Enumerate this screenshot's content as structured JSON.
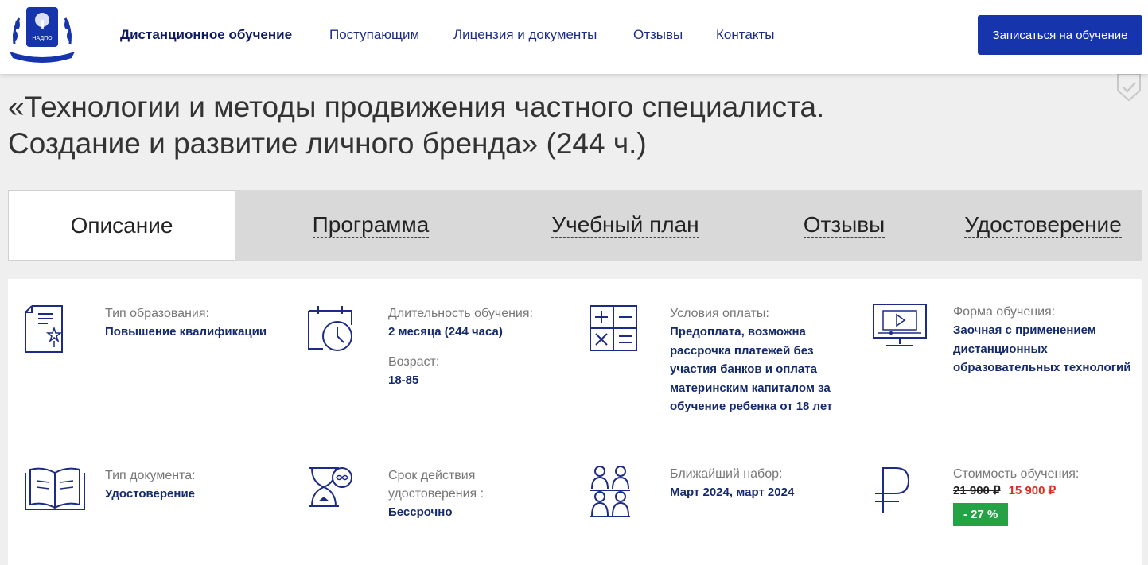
{
  "header": {
    "logo_text": "НАДПО",
    "nav": [
      "Дистанционное обучение",
      "Поступающим",
      "Лицензия и документы",
      "Отзывы",
      "Контакты"
    ],
    "cta_label": "Записаться на обучение"
  },
  "title": {
    "line1": "«Технологии и методы продвижения частного специалиста.",
    "line2": "Создание и развитие личного бренда» (244 ч.)"
  },
  "tabs": [
    "Описание",
    "Программа",
    "Учебный план",
    "Отзывы",
    "Удостоверение"
  ],
  "info": {
    "edu_type": {
      "label": "Тип образования:",
      "value": "Повышение квалификации"
    },
    "duration": {
      "label": "Длительность обучения:",
      "value": "2 месяца (244 часа)",
      "age_label": "Возраст:",
      "age_value": "18-85"
    },
    "payment": {
      "label": "Условия оплаты:",
      "value": "Предоплата, возможна рассрочка платежей без участия банков и оплата материнским капиталом за обучение ребенка от 18 лет"
    },
    "form": {
      "label": "Форма обучения:",
      "value": "Заочная с применением дистанционных образовательных технологий"
    },
    "doc_type": {
      "label": "Тип документа:",
      "value": "Удостоверение"
    },
    "validity": {
      "label": "Срок действия удостоверения :",
      "value": "Бессрочно"
    },
    "intake": {
      "label": "Ближайший набор:",
      "value": "Март 2024, март 2024"
    },
    "price": {
      "label": "Стоимость обучения:",
      "old": "21 900 ₽",
      "new": "15 900 ₽",
      "discount": "- 27 %"
    }
  },
  "colors": {
    "accent": "#1634ac",
    "text_blue": "#152a6c",
    "price_red": "#e02a1d",
    "discount_green": "#26a246"
  }
}
